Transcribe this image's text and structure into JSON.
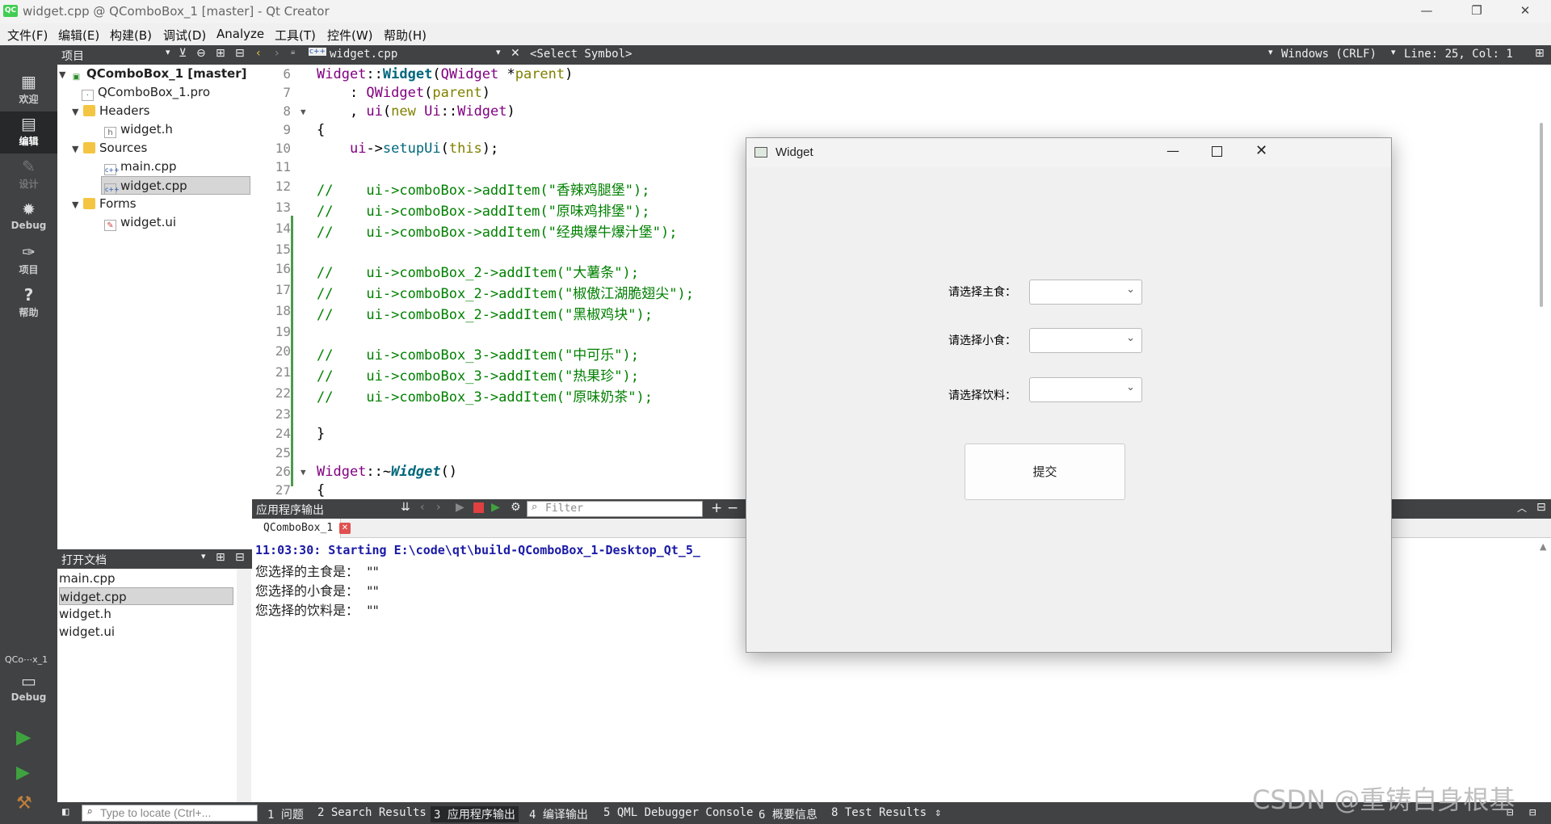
{
  "window": {
    "title": "widget.cpp @ QComboBox_1 [master] - Qt Creator",
    "logo": "QC"
  },
  "menu": [
    "文件(F)",
    "编辑(E)",
    "构建(B)",
    "调试(D)",
    "Analyze",
    "工具(T)",
    "控件(W)",
    "帮助(H)"
  ],
  "modes": [
    {
      "label": "欢迎",
      "icon": "grid-icon"
    },
    {
      "label": "编辑",
      "icon": "document-icon"
    },
    {
      "label": "设计",
      "icon": "pencil-icon"
    },
    {
      "label": "Debug",
      "icon": "bug-icon"
    },
    {
      "label": "项目",
      "icon": "wrench-icon"
    },
    {
      "label": "帮助",
      "icon": "help-icon"
    }
  ],
  "kit": {
    "name": "QCo⋯x_1",
    "label": "Debug"
  },
  "project": {
    "header": "项目",
    "tree": [
      "QComboBox_1 [master]",
      "QComboBox_1.pro",
      "Headers",
      "widget.h",
      "Sources",
      "main.cpp",
      "widget.cpp",
      "Forms",
      "widget.ui"
    ]
  },
  "opendocs": {
    "header": "打开文档",
    "items": [
      "main.cpp",
      "widget.cpp",
      "widget.h",
      "widget.ui"
    ]
  },
  "editor": {
    "file": "widget.cpp",
    "symbol": "<Select Symbol>",
    "encoding": "Windows (CRLF)",
    "position": "Line: 25, Col: 1",
    "line_numbers": [
      "6",
      "7",
      "8",
      "9",
      "10",
      "11",
      "12",
      "13",
      "14",
      "15",
      "16",
      "17",
      "18",
      "19",
      "20",
      "21",
      "22",
      "23",
      "24",
      "25",
      "26",
      "27"
    ],
    "comments": [
      "//    ui->comboBox->addItem(\"香辣鸡腿堡\");",
      "//    ui->comboBox->addItem(\"原味鸡排堡\");",
      "//    ui->comboBox->addItem(\"经典爆牛爆汁堡\");",
      "//    ui->comboBox_2->addItem(\"大薯条\");",
      "//    ui->comboBox_2->addItem(\"椒傲江湖脆翅尖\");",
      "//    ui->comboBox_2->addItem(\"黑椒鸡块\");",
      "//    ui->comboBox_3->addItem(\"中可乐\");",
      "//    ui->comboBox_3->addItem(\"热果珍\");",
      "//    ui->comboBox_3->addItem(\"原味奶茶\");"
    ],
    "brace_open": "{",
    "brace_close": "}"
  },
  "output": {
    "header": "应用程序输出",
    "filter_placeholder": "Filter",
    "tab": "QComboBox_1",
    "lines": [
      "11:03:30: Starting E:\\code\\qt\\build-QComboBox_1-Desktop_Qt_5_",
      "您选择的主食是：  \"\"",
      "您选择的小食是：  \"\"",
      "您选择的饮料是：  \"\""
    ]
  },
  "status": {
    "locate_placeholder": "Type to locate (Ctrl+...",
    "tabs": [
      "1 问题",
      "2 Search Results",
      "3 应用程序输出",
      "4 编译输出",
      "5 QML Debugger Console",
      "6 概要信息",
      "8 Test Results"
    ]
  },
  "widget": {
    "title": "Widget",
    "labels": [
      "请选择主食：",
      "请选择小食：",
      "请选择饮料："
    ],
    "submit": "提交"
  },
  "watermark": "CSDN @重铸自身根基"
}
